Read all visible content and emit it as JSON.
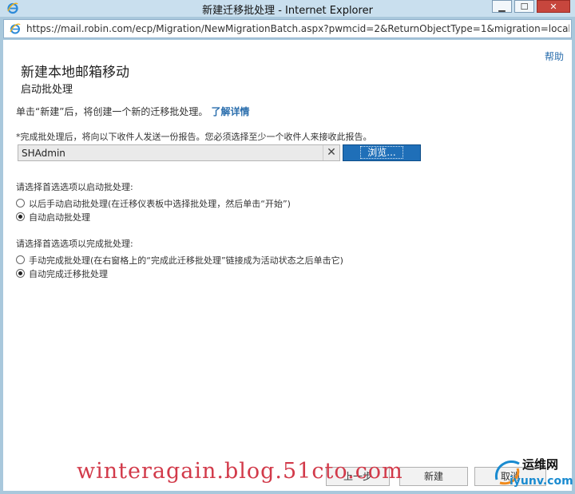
{
  "window": {
    "title": "新建迁移批处理 - Internet Explorer",
    "minimize": "▁",
    "maximize": "☐",
    "close": "✕"
  },
  "addressbar": {
    "url": "https://mail.robin.com/ecp/Migration/NewMigrationBatch.aspx?pwmcid=2&ReturnObjectType=1&migration=localmove"
  },
  "page": {
    "help": "帮助",
    "title": "新建本地邮箱移动",
    "subtitle": "启动批处理",
    "intro": "单击“新建”后，将创建一个新的迁移批处理。",
    "learn_more": "了解详情",
    "notice": "*完成批处理后，将向以下收件人发送一份报告。您必须选择至少一个收件人来接收此报告。",
    "recipient_value": "SHAdmin",
    "clear_glyph": "✕",
    "browse_label": "浏览..."
  },
  "start_group": {
    "label": "请选择首选选项以启动批处理:",
    "options": [
      {
        "label": "以后手动启动批处理(在迁移仪表板中选择批处理，然后单击“开始”)",
        "checked": false
      },
      {
        "label": "自动启动批处理",
        "checked": true
      }
    ]
  },
  "complete_group": {
    "label": "请选择首选选项以完成批处理:",
    "options": [
      {
        "label": "手动完成批处理(在右窗格上的“完成此迁移批处理”链接成为活动状态之后单击它)",
        "checked": false
      },
      {
        "label": "自动完成迁移批处理",
        "checked": true
      }
    ]
  },
  "footer": {
    "prev_label": "上一步",
    "create_label": "新建",
    "cancel_label": "取消"
  },
  "watermark": {
    "text": "winteragain.blog.51cto.com",
    "logo_cn": "运维网",
    "logo_domain": "iyunv.com"
  },
  "colors": {
    "accent": "#1f6fb8",
    "link": "#2a6ead",
    "watermark": "#d23a4a"
  }
}
